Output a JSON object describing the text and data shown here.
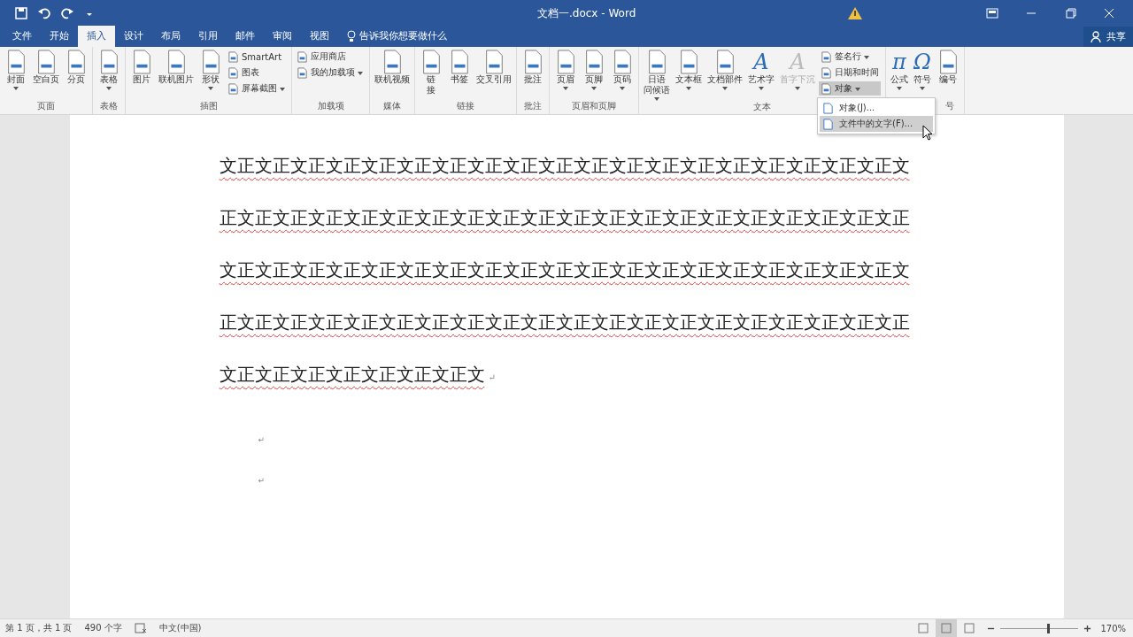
{
  "window": {
    "title": "文档一.docx - Word"
  },
  "tabs": [
    {
      "label": "文件",
      "selected": false
    },
    {
      "label": "开始",
      "selected": false
    },
    {
      "label": "插入",
      "selected": true
    },
    {
      "label": "设计",
      "selected": false
    },
    {
      "label": "布局",
      "selected": false
    },
    {
      "label": "引用",
      "selected": false
    },
    {
      "label": "邮件",
      "selected": false
    },
    {
      "label": "审阅",
      "selected": false
    },
    {
      "label": "视图",
      "selected": false
    }
  ],
  "tell_me": "告诉我你想要做什么",
  "share_button": "共享",
  "ribbon": {
    "groups": [
      {
        "label": "页面",
        "items": [
          {
            "kind": "large",
            "label": "封面",
            "dropdown": true
          },
          {
            "kind": "large",
            "label": "空白页",
            "dropdown": false
          },
          {
            "kind": "large",
            "label": "分页",
            "dropdown": false
          }
        ]
      },
      {
        "label": "表格",
        "items": [
          {
            "kind": "large",
            "label": "表格",
            "dropdown": true
          }
        ]
      },
      {
        "label": "插图",
        "items": [
          {
            "kind": "large",
            "label": "图片",
            "dropdown": false
          },
          {
            "kind": "large",
            "label": "联机图片",
            "dropdown": false
          },
          {
            "kind": "large",
            "label": "形状",
            "dropdown": true
          },
          {
            "kind": "stack",
            "items": [
              {
                "label": "SmartArt",
                "dropdown": false,
                "pressed": false
              },
              {
                "label": "图表",
                "dropdown": false,
                "pressed": false
              },
              {
                "label": "屏幕截图",
                "dropdown": true,
                "pressed": false
              }
            ]
          }
        ]
      },
      {
        "label": "加载项",
        "items": [
          {
            "kind": "stack",
            "items": [
              {
                "label": "应用商店",
                "dropdown": false,
                "pressed": false
              },
              {
                "label": "我的加载项",
                "dropdown": true,
                "pressed": false
              }
            ]
          }
        ]
      },
      {
        "label": "媒体",
        "items": [
          {
            "kind": "large",
            "label": "联机视频",
            "dropdown": false
          }
        ]
      },
      {
        "label": "链接",
        "items": [
          {
            "kind": "large",
            "label": [
              "链",
              "接"
            ],
            "dropdown": false
          },
          {
            "kind": "large",
            "label": "书签",
            "dropdown": false
          },
          {
            "kind": "large",
            "label": "交叉引用",
            "dropdown": false
          }
        ]
      },
      {
        "label": "批注",
        "items": [
          {
            "kind": "large",
            "label": "批注",
            "dropdown": false
          }
        ]
      },
      {
        "label": "页眉和页脚",
        "items": [
          {
            "kind": "large",
            "label": "页眉",
            "dropdown": true
          },
          {
            "kind": "large",
            "label": "页脚",
            "dropdown": true
          },
          {
            "kind": "large",
            "label": "页码",
            "dropdown": true
          }
        ]
      },
      {
        "label": "文本",
        "items": [
          {
            "kind": "large",
            "label": [
              "日语",
              "问候语"
            ],
            "dropdown": true
          },
          {
            "kind": "large",
            "label": "文本框",
            "dropdown": true
          },
          {
            "kind": "large",
            "label": "文档部件",
            "dropdown": true
          },
          {
            "kind": "glyph",
            "glyph": "A",
            "label": "艺术字",
            "dropdown": true,
            "disabled": false
          },
          {
            "kind": "glyph",
            "glyph": "A",
            "label": "首字下沉",
            "dropdown": true,
            "disabled": true
          },
          {
            "kind": "stack",
            "items": [
              {
                "label": "签名行",
                "dropdown": true,
                "pressed": false
              },
              {
                "label": "日期和时间",
                "dropdown": false,
                "pressed": false
              },
              {
                "label": "对象",
                "dropdown": true,
                "pressed": true
              }
            ]
          }
        ]
      },
      {
        "label": "号",
        "items": [
          {
            "kind": "glyph",
            "glyph": "π",
            "label": "公式",
            "dropdown": true,
            "disabled": false
          },
          {
            "kind": "glyph",
            "glyph": "Ω",
            "label": "符号",
            "dropdown": true,
            "disabled": false
          },
          {
            "kind": "large",
            "label": "编号",
            "dropdown": false
          }
        ]
      }
    ]
  },
  "dropdown_menu": {
    "items": [
      {
        "label": "对象(J)...",
        "selected": false
      },
      {
        "label": "文件中的文字(F)...",
        "selected": true
      }
    ]
  },
  "document": {
    "body_text": "文正文正文正文正文正文正文正文正文正文正文正文正文正文正文正文正文正文正文正文正文正文正文正文正文正文正文正文正文正文正文正文正文正文正文正文正文正文正文正文正文正文正文正文正文正文正文正文正文正文正文正文正文正文正文正文正文正文正文正文正文正文正文正文正文正文正文正文正文正文正文正文正文正文正文正文正文正文正文正文正文正文正文正文正文正文",
    "paragraph_mark": "↵",
    "empty_paragraphs": [
      "↵",
      "↵"
    ]
  },
  "status_bar": {
    "page": "第 1 页，共 1 页",
    "words": "490 个字",
    "language": "中文(中国)",
    "views": [
      {
        "selected": false
      },
      {
        "selected": true
      },
      {
        "selected": false
      }
    ],
    "zoom": {
      "level": 0.62,
      "label": "170%"
    }
  }
}
